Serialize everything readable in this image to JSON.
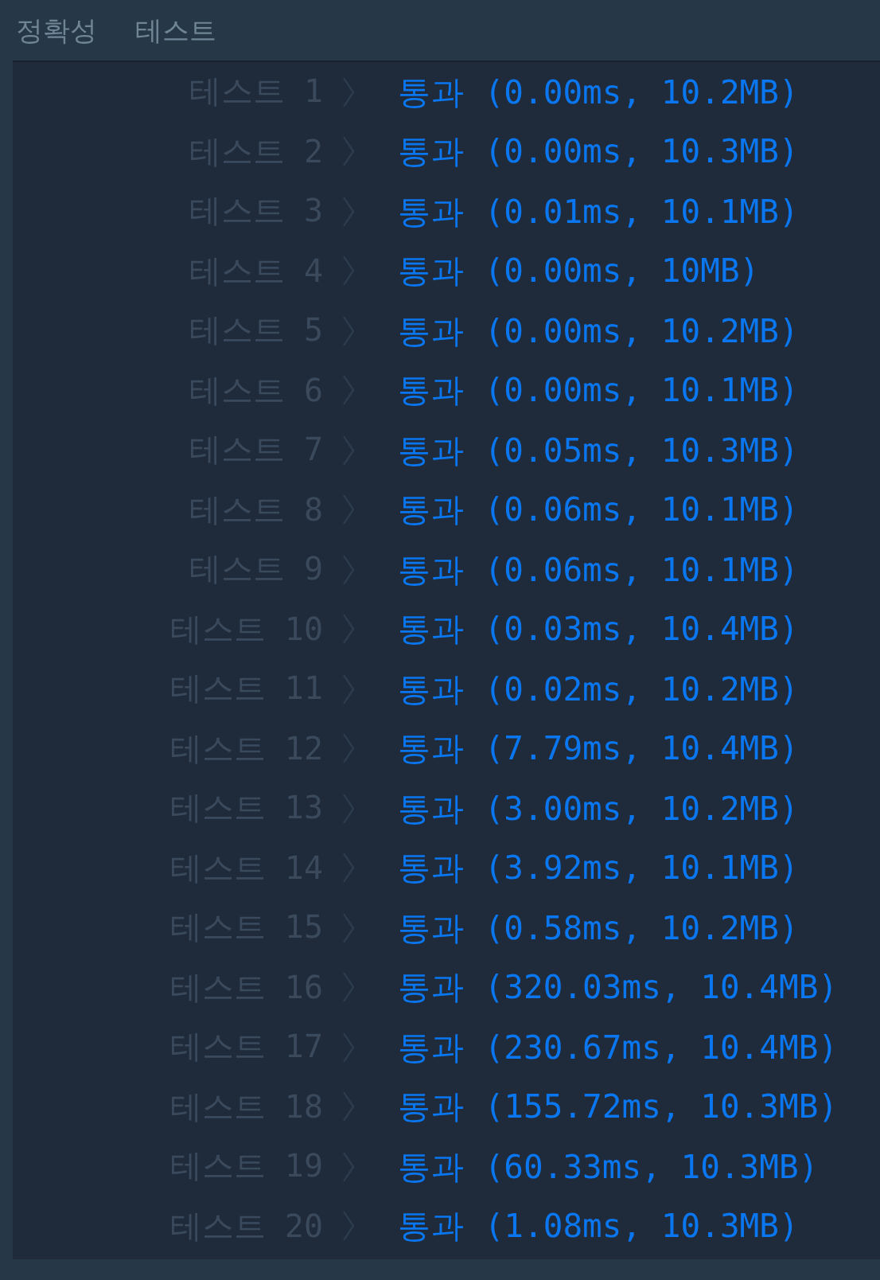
{
  "tabs": [
    {
      "label": "정확성"
    },
    {
      "label": "테스트"
    }
  ],
  "tests": [
    {
      "label": "테스트 1",
      "result": "통과 (0.00ms, 10.2MB)"
    },
    {
      "label": "테스트 2",
      "result": "통과 (0.00ms, 10.3MB)"
    },
    {
      "label": "테스트 3",
      "result": "통과 (0.01ms, 10.1MB)"
    },
    {
      "label": "테스트 4",
      "result": "통과 (0.00ms, 10MB)"
    },
    {
      "label": "테스트 5",
      "result": "통과 (0.00ms, 10.2MB)"
    },
    {
      "label": "테스트 6",
      "result": "통과 (0.00ms, 10.1MB)"
    },
    {
      "label": "테스트 7",
      "result": "통과 (0.05ms, 10.3MB)"
    },
    {
      "label": "테스트 8",
      "result": "통과 (0.06ms, 10.1MB)"
    },
    {
      "label": "테스트 9",
      "result": "통과 (0.06ms, 10.1MB)"
    },
    {
      "label": "테스트 10",
      "result": "통과 (0.03ms, 10.4MB)"
    },
    {
      "label": "테스트 11",
      "result": "통과 (0.02ms, 10.2MB)"
    },
    {
      "label": "테스트 12",
      "result": "통과 (7.79ms, 10.4MB)"
    },
    {
      "label": "테스트 13",
      "result": "통과 (3.00ms, 10.2MB)"
    },
    {
      "label": "테스트 14",
      "result": "통과 (3.92ms, 10.1MB)"
    },
    {
      "label": "테스트 15",
      "result": "통과 (0.58ms, 10.2MB)"
    },
    {
      "label": "테스트 16",
      "result": "통과 (320.03ms, 10.4MB)"
    },
    {
      "label": "테스트 17",
      "result": "통과 (230.67ms, 10.4MB)"
    },
    {
      "label": "테스트 18",
      "result": "통과 (155.72ms, 10.3MB)"
    },
    {
      "label": "테스트 19",
      "result": "통과 (60.33ms, 10.3MB)"
    },
    {
      "label": "테스트 20",
      "result": "통과 (1.08ms, 10.3MB)"
    }
  ]
}
